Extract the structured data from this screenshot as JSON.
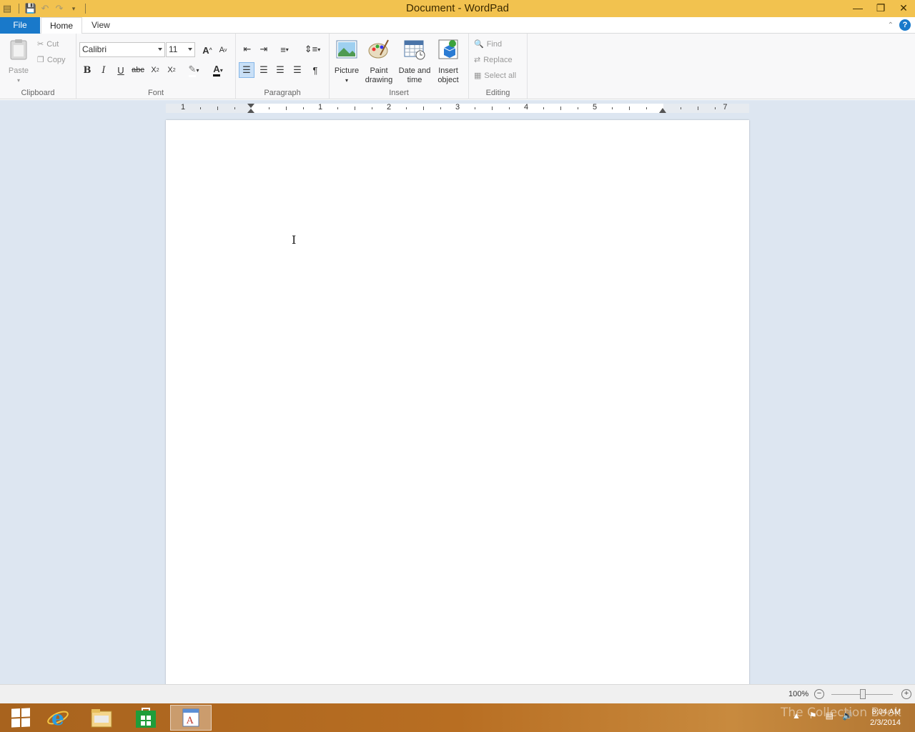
{
  "window": {
    "title": "Document - WordPad"
  },
  "tabs": [
    {
      "label": "File"
    },
    {
      "label": "Home"
    },
    {
      "label": "View"
    }
  ],
  "ribbon": {
    "clipboard": {
      "paste": "Paste",
      "cut": "Cut",
      "copy": "Copy",
      "label": "Clipboard"
    },
    "font": {
      "family": "Calibri",
      "size": "11",
      "label": "Font"
    },
    "paragraph": {
      "label": "Paragraph"
    },
    "insert": {
      "picture": "Picture",
      "paint_drawing_1": "Paint",
      "paint_drawing_2": "drawing",
      "date_time_1": "Date and",
      "date_time_2": "time",
      "insert_object_1": "Insert",
      "insert_object_2": "object",
      "label": "Insert"
    },
    "editing": {
      "find": "Find",
      "replace": "Replace",
      "select_all": "Select all",
      "label": "Editing"
    }
  },
  "ruler": {
    "numbers": [
      "1",
      "1",
      "2",
      "3",
      "4",
      "5",
      "7"
    ]
  },
  "status": {
    "zoom": "100%"
  },
  "taskbar": {
    "time": "8:04 AM",
    "date": "2/3/2014",
    "watermark": "The Collection Book"
  },
  "colors": {
    "titlebar": "#f2c24f",
    "file_tab": "#1979ca",
    "workspace": "#dde6f1",
    "taskbar": "#b86e22"
  }
}
